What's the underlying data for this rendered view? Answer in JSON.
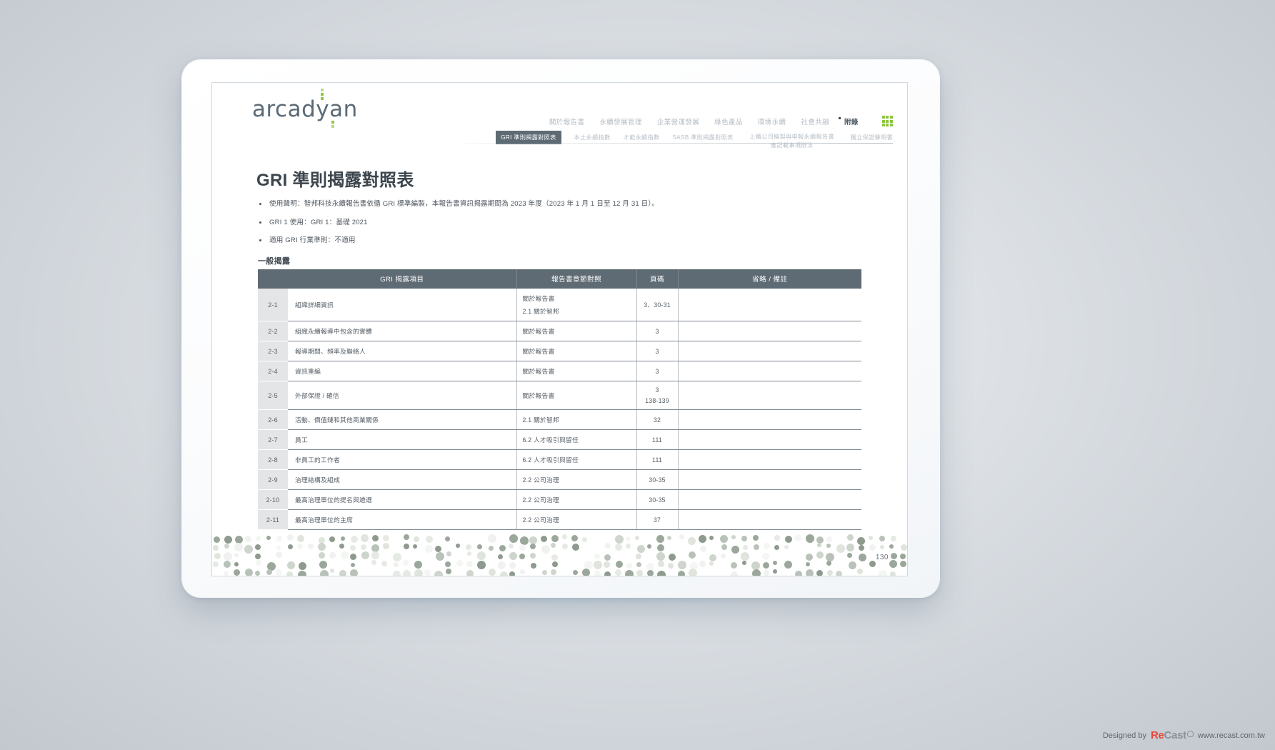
{
  "brand": {
    "logo_text": "arcadyan"
  },
  "topnav": {
    "items": [
      {
        "label": "關於報告書",
        "active": false
      },
      {
        "label": "永續發展管理",
        "active": false
      },
      {
        "label": "企業營運發展",
        "active": false
      },
      {
        "label": "綠色產品",
        "active": false
      },
      {
        "label": "環境永續",
        "active": false
      },
      {
        "label": "社會共融",
        "active": false
      },
      {
        "label": "附錄",
        "active": true
      }
    ],
    "grid_icon": "grid-menu-icon",
    "accent_color": "#8dc63f"
  },
  "subnav": {
    "items": [
      {
        "label": "GRI 準則揭露對照表",
        "active": true
      },
      {
        "label": "本土永續指數",
        "active": false
      },
      {
        "label": "才能永續指數",
        "active": false
      },
      {
        "label": "SASB 準則揭露對照表",
        "active": false
      },
      {
        "label": "上櫃公司編製與申報永續報告書\n應記載事項辦法",
        "active": false,
        "two_line": true
      },
      {
        "label": "獨立保證聲明書",
        "active": false
      }
    ]
  },
  "document": {
    "title": "GRI 準則揭露對照表",
    "bullets": [
      "使用聲明：智邦科技永續報告書依循 GRI 標準編製，本報告書資訊揭露期間為 2023 年度（2023 年 1 月 1 日至 12 月 31 日）。",
      "GRI 1 使用：GRI 1：基礎 2021",
      "適用 GRI 行業準則：不適用"
    ],
    "section_heading": "一般揭露",
    "page_number": "130"
  },
  "table": {
    "headers": [
      "",
      "GRI 揭露項目",
      "報告書章節對照",
      "頁碼",
      "省略 / 備註"
    ],
    "rows": [
      {
        "id": "2-1",
        "item": "組織詳細資訊",
        "section": "關於報告書",
        "section2": "2.1 關於智邦",
        "page": "3、30-31",
        "note": "",
        "tall": true
      },
      {
        "id": "2-2",
        "item": "組織永續報導中包含的實體",
        "section": "關於報告書",
        "section2": "",
        "page": "3",
        "note": ""
      },
      {
        "id": "2-3",
        "item": "報導期間、頻率及聯絡人",
        "section": "關於報告書",
        "section2": "",
        "page": "3",
        "note": ""
      },
      {
        "id": "2-4",
        "item": "資訊重編",
        "section": "關於報告書",
        "section2": "",
        "page": "3",
        "note": ""
      },
      {
        "id": "2-5",
        "item": "外部保證 / 確信",
        "section": "關於報告書",
        "section2": "",
        "page": "3",
        "page2": "138-139",
        "note": "",
        "tall": true
      },
      {
        "id": "2-6",
        "item": "活動、價值鏈和其他商業關係",
        "section": "2.1 關於智邦",
        "section2": "",
        "page": "32",
        "note": ""
      },
      {
        "id": "2-7",
        "item": "員工",
        "section": "6.2 人才吸引與留任",
        "section2": "",
        "page": "111",
        "note": ""
      },
      {
        "id": "2-8",
        "item": "非員工的工作者",
        "section": "6.2 人才吸引與留任",
        "section2": "",
        "page": "111",
        "note": ""
      },
      {
        "id": "2-9",
        "item": "治理結構及組成",
        "section": "2.2 公司治理",
        "section2": "",
        "page": "30-35",
        "note": ""
      },
      {
        "id": "2-10",
        "item": "最高治理單位的提名與遴選",
        "section": "2.2 公司治理",
        "section2": "",
        "page": "30-35",
        "note": ""
      },
      {
        "id": "2-11",
        "item": "最高治理單位的主席",
        "section": "2.2 公司治理",
        "section2": "",
        "page": "37",
        "note": ""
      }
    ]
  },
  "credit": {
    "designed_by": "Designed by",
    "brand_re": "Re",
    "brand_cast": "Cast",
    "website": "www.recast.com.tw"
  }
}
